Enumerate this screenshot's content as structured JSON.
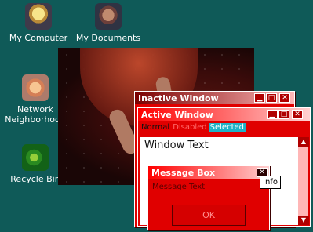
{
  "desktop": {
    "icons": [
      {
        "label": "My Computer",
        "icon": "computer-icon"
      },
      {
        "label": "My Documents",
        "icon": "documents-icon"
      },
      {
        "label": "Network\nNeighborhood",
        "icon": "network-icon"
      },
      {
        "label": "Recycle Bin",
        "icon": "recycle-bin-icon"
      }
    ]
  },
  "windows": {
    "inactive": {
      "title": "Inactive Window"
    },
    "active": {
      "title": "Active Window",
      "menu": {
        "normal": "Normal",
        "disabled": "Disabled",
        "selected": "Selected"
      },
      "content": "Window Text"
    },
    "message_box": {
      "title": "Message Box",
      "text": "Message Text",
      "ok_label": "OK",
      "close_symbol": "✕"
    }
  },
  "tooltip": {
    "text": "Info"
  },
  "colors": {
    "desktop": "#0f5a58",
    "window_frame": "#e00000",
    "selected": "#1fb2c6"
  }
}
